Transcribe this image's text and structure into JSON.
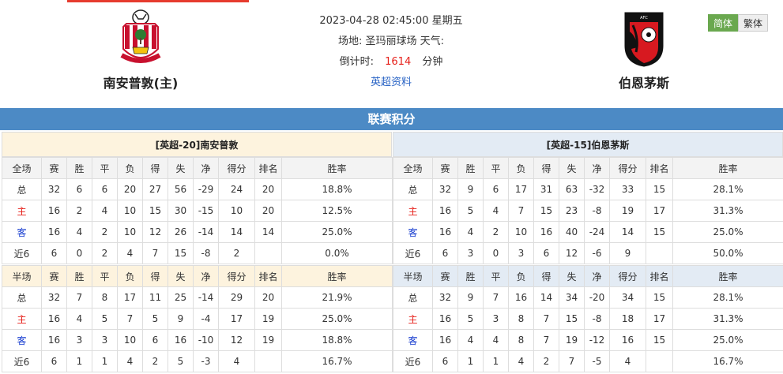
{
  "home_team": {
    "name": "南安普敦(主)"
  },
  "away_team": {
    "name": "伯恩茅斯"
  },
  "match": {
    "datetime": "2023-04-28 02:45:00 星期五",
    "venue_label": "场地:",
    "venue": "圣玛丽球场",
    "weather_label": "天气:",
    "countdown_label": "倒计时:",
    "countdown_value": "1614",
    "countdown_unit": "分钟",
    "league_link": "英超资料"
  },
  "lang": {
    "simplified": "简体",
    "traditional": "繁体"
  },
  "section_title": "联赛积分",
  "columns_full": [
    "全场",
    "赛",
    "胜",
    "平",
    "负",
    "得",
    "失",
    "净",
    "得分",
    "排名",
    "胜率"
  ],
  "columns_half": [
    "半场",
    "赛",
    "胜",
    "平",
    "负",
    "得",
    "失",
    "净",
    "得分",
    "排名",
    "胜率"
  ],
  "left_panel": {
    "title": "[英超-20]南安普敦",
    "full": [
      [
        "总",
        "32",
        "6",
        "6",
        "20",
        "27",
        "56",
        "-29",
        "24",
        "20",
        "18.8%"
      ],
      [
        "主",
        "16",
        "2",
        "4",
        "10",
        "15",
        "30",
        "-15",
        "10",
        "20",
        "12.5%"
      ],
      [
        "客",
        "16",
        "4",
        "2",
        "10",
        "12",
        "26",
        "-14",
        "14",
        "14",
        "25.0%"
      ],
      [
        "近6",
        "6",
        "0",
        "2",
        "4",
        "7",
        "15",
        "-8",
        "2",
        "",
        "0.0%"
      ]
    ],
    "half": [
      [
        "总",
        "32",
        "7",
        "8",
        "17",
        "11",
        "25",
        "-14",
        "29",
        "20",
        "21.9%"
      ],
      [
        "主",
        "16",
        "4",
        "5",
        "7",
        "5",
        "9",
        "-4",
        "17",
        "19",
        "25.0%"
      ],
      [
        "客",
        "16",
        "3",
        "3",
        "10",
        "6",
        "16",
        "-10",
        "12",
        "19",
        "18.8%"
      ],
      [
        "近6",
        "6",
        "1",
        "1",
        "4",
        "2",
        "5",
        "-3",
        "4",
        "",
        "16.7%"
      ]
    ]
  },
  "right_panel": {
    "title": "[英超-15]伯恩茅斯",
    "full": [
      [
        "总",
        "32",
        "9",
        "6",
        "17",
        "31",
        "63",
        "-32",
        "33",
        "15",
        "28.1%"
      ],
      [
        "主",
        "16",
        "5",
        "4",
        "7",
        "15",
        "23",
        "-8",
        "19",
        "17",
        "31.3%"
      ],
      [
        "客",
        "16",
        "4",
        "2",
        "10",
        "16",
        "40",
        "-24",
        "14",
        "15",
        "25.0%"
      ],
      [
        "近6",
        "6",
        "3",
        "0",
        "3",
        "6",
        "12",
        "-6",
        "9",
        "",
        "50.0%"
      ]
    ],
    "half": [
      [
        "总",
        "32",
        "9",
        "7",
        "16",
        "14",
        "34",
        "-20",
        "34",
        "15",
        "28.1%"
      ],
      [
        "主",
        "16",
        "5",
        "3",
        "8",
        "7",
        "15",
        "-8",
        "18",
        "17",
        "31.3%"
      ],
      [
        "客",
        "16",
        "4",
        "4",
        "8",
        "7",
        "19",
        "-12",
        "16",
        "15",
        "25.0%"
      ],
      [
        "近6",
        "6",
        "1",
        "1",
        "4",
        "2",
        "7",
        "-5",
        "4",
        "",
        "16.7%"
      ]
    ]
  },
  "colors": {
    "accent": "#4c8ac5",
    "home_label": "#e6201a",
    "away_label": "#1a3fd0",
    "countdown": "#e6201a",
    "lang_active": "#6aa84f"
  },
  "icons": {
    "home_logo": "southampton-crest-icon",
    "away_logo": "bournemouth-crest-icon"
  }
}
